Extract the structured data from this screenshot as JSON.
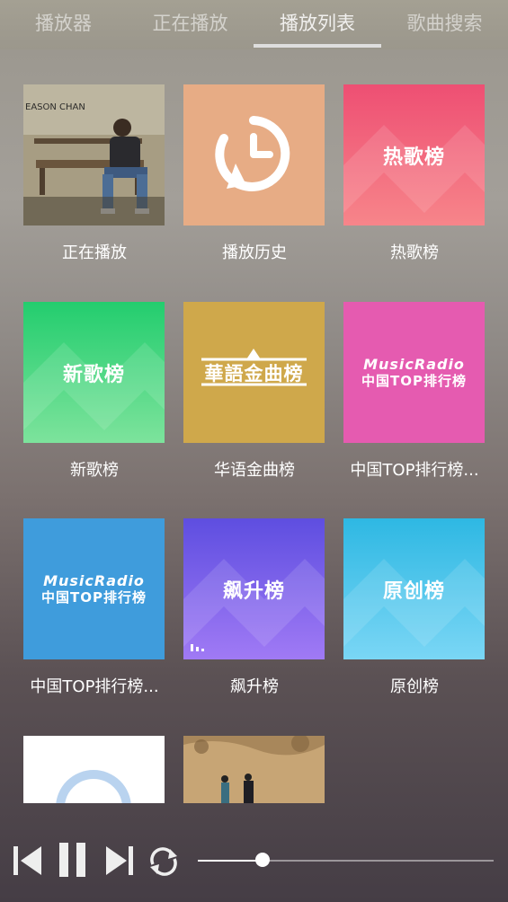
{
  "tabs": [
    {
      "label": "播放器",
      "active": false
    },
    {
      "label": "正在播放",
      "active": false
    },
    {
      "label": "播放列表",
      "active": true
    },
    {
      "label": "歌曲搜索",
      "active": false
    }
  ],
  "album_art_text": {
    "eason_name": "EASON CHAN",
    "history_icon": "history-clock-icon"
  },
  "tiles": [
    {
      "label": "正在播放",
      "cover": "eason-chan-album"
    },
    {
      "label": "播放历史",
      "cover": "history-icon",
      "color": "#e7ac85"
    },
    {
      "label": "热歌榜",
      "cover_text": "热歌榜",
      "color": "#f06479"
    },
    {
      "label": "新歌榜",
      "cover_text": "新歌榜",
      "color": "#46d27d"
    },
    {
      "label": "华语金曲榜",
      "cover_text": "華語金曲榜",
      "color": "#d0a84a"
    },
    {
      "label": "中国TOP排行榜...",
      "cover_text_1": "MusicRadio",
      "cover_text_2": "中国TOP排行榜",
      "color": "#e55bb0"
    },
    {
      "label": "中国TOP排行榜...",
      "cover_text_1": "MusicRadio",
      "cover_text_2": "中国TOP排行榜",
      "color": "#3f9cdc"
    },
    {
      "label": "飙升榜",
      "cover_text": "飙升榜",
      "color": "#7a5ae0"
    },
    {
      "label": "原创榜",
      "cover_text": "原创榜",
      "color": "#52c6ea"
    },
    {
      "label": "",
      "cover": "light-blue-ring"
    },
    {
      "label": "",
      "cover": "painting-couple"
    }
  ],
  "player": {
    "progress": 0.22,
    "icons": [
      "skip-previous-icon",
      "pause-icon",
      "skip-next-icon",
      "repeat-icon"
    ]
  }
}
